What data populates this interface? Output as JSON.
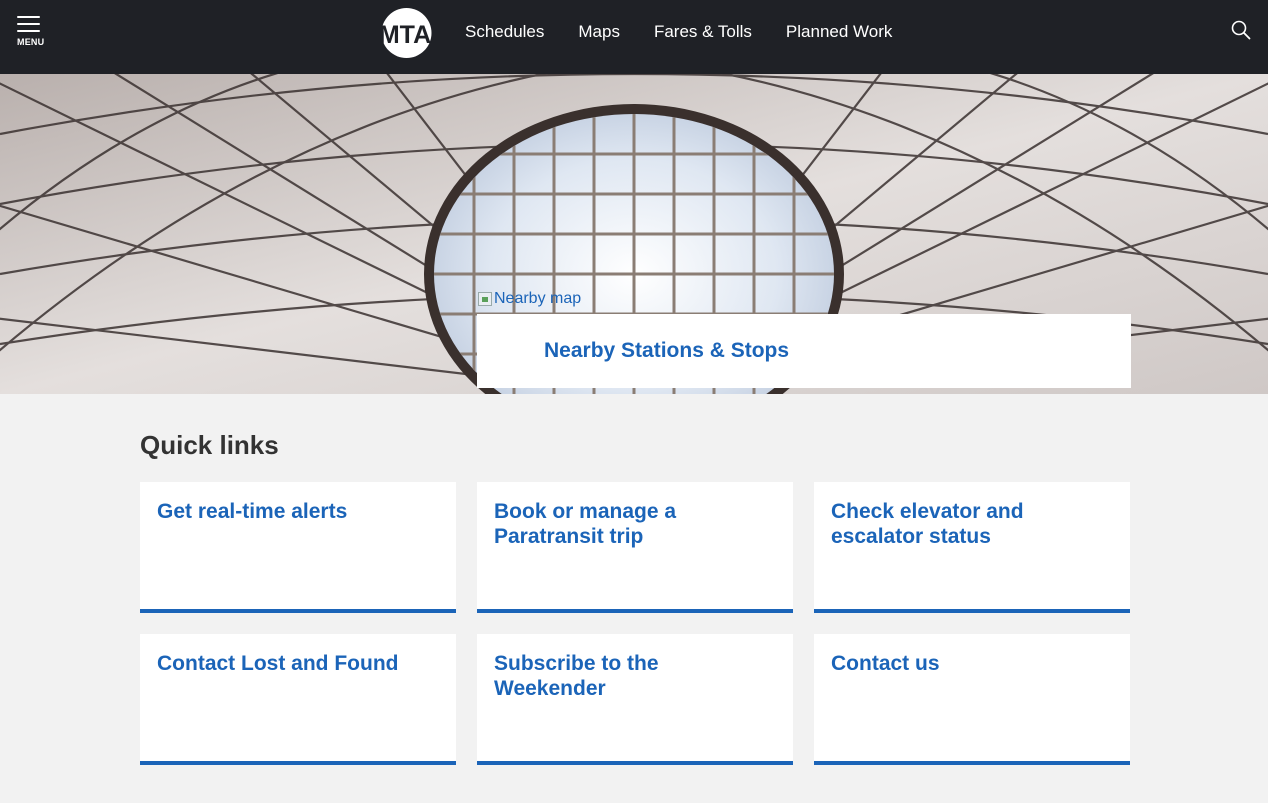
{
  "header": {
    "menu_label": "MENU",
    "logo_text": "MTA",
    "nav": [
      "Schedules",
      "Maps",
      "Fares & Tolls",
      "Planned Work"
    ]
  },
  "hero": {
    "map_alt": "Nearby map",
    "nearby_link": "Nearby Stations & Stops"
  },
  "quick_links": {
    "title": "Quick links",
    "items": [
      "Get real-time alerts",
      "Book or manage a Paratransit trip",
      "Check elevator and escalator status",
      "Contact Lost and Found",
      "Subscribe to the Weekender",
      "Contact us"
    ]
  },
  "colors": {
    "header_bg": "#1f2126",
    "link_blue": "#1b64b8",
    "page_bg": "#f2f2f2"
  }
}
